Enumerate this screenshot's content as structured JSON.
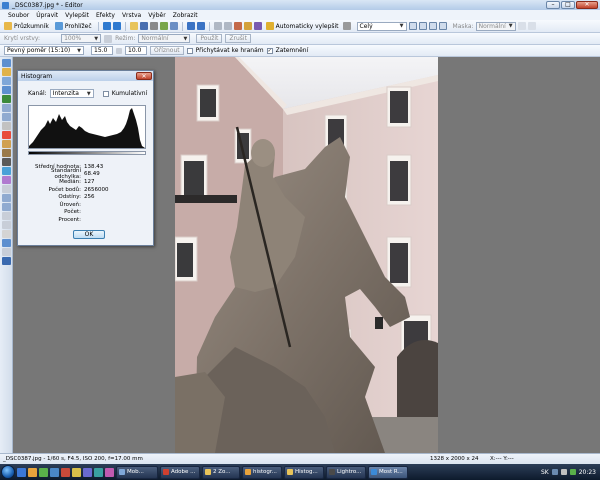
{
  "window": {
    "title": "_DSC0387.jpg * - Editor",
    "minimize": "–",
    "maximize": "□",
    "close": "✕"
  },
  "menu": [
    "Soubor",
    "Úpravit",
    "Vylepšit",
    "Efekty",
    "Vrstva",
    "Výběr",
    "Zobrazit"
  ],
  "toolbar1": {
    "explorer_label": "Průzkumník",
    "viewer_label": "Prohlížeč",
    "auto_enhance_label": "Automaticky vylepšit",
    "view_combo": "Celý",
    "mask_label": "Maska:",
    "mask_combo": "Normální"
  },
  "toolbar2": {
    "opacity_label": "Krytí vrstvy:",
    "opacity_value": "100%",
    "mode_label": "Režim:",
    "mode_value": "Normální",
    "apply_label": "Použít",
    "cancel_label": "Zrušit"
  },
  "toolbar3": {
    "ratio_combo": "Pevný poměr (15:10)",
    "ratio_w": "15.0",
    "ratio_h": "10.0",
    "crop_label": "Oříznout",
    "snap_label": "Přichytávat ke hranám",
    "darken_label": "Zatemnění"
  },
  "histogram": {
    "title": "Histogram",
    "close": "✕",
    "channel_label": "Kanál:",
    "channel_value": "Intenzita",
    "cumulative_label": "Kumulativní",
    "stats": [
      {
        "label": "Střední hodnota:",
        "value": "138.43"
      },
      {
        "label": "Standardní odchylka:",
        "value": "68.49"
      },
      {
        "label": "Medián:",
        "value": "127"
      },
      {
        "label": "Počet bodů:",
        "value": "2656000"
      },
      {
        "label": "Odstíny:",
        "value": "256"
      },
      {
        "label": "Úroveň:",
        "value": ""
      },
      {
        "label": "Počet:",
        "value": ""
      },
      {
        "label": "Procent:",
        "value": ""
      }
    ],
    "ok_label": "OK"
  },
  "status": {
    "info": "_DSC0387.jpg - 1/60 s, F4.5, ISO 200, f=17.00 mm",
    "dims": "1328 x 2000 x 24",
    "xy": "X:---  Y:---"
  },
  "taskbar": {
    "tasks": [
      "Mob...",
      "Adobe ...",
      "2 Zo...",
      "histogr...",
      "Histog...",
      "Lightro...",
      "Most R..."
    ],
    "lang": "SK",
    "time": "20:23"
  }
}
